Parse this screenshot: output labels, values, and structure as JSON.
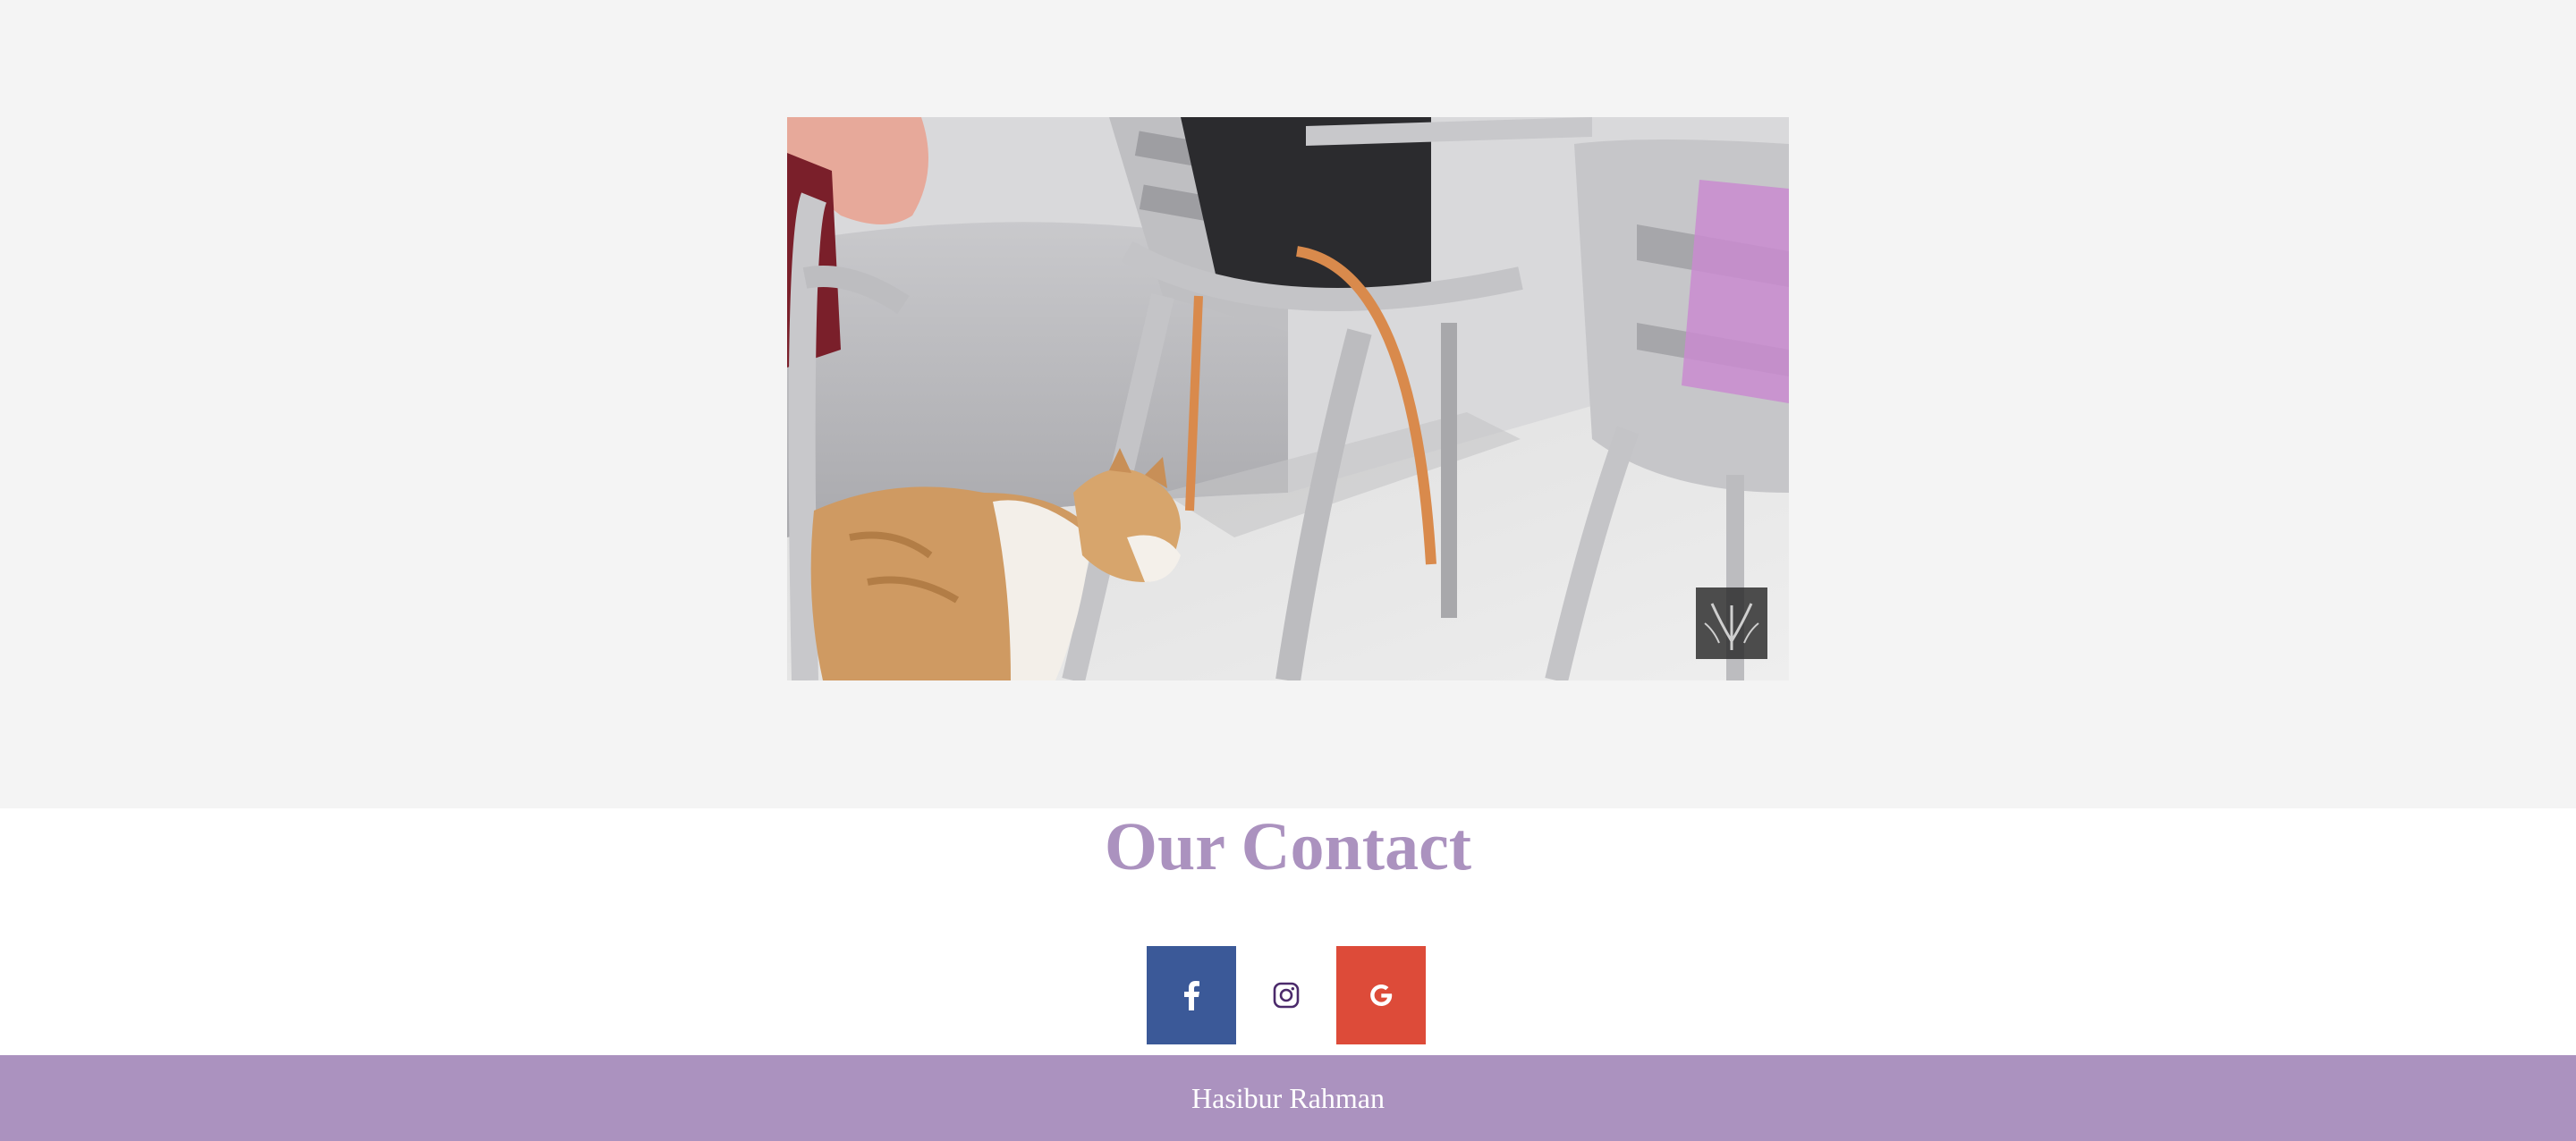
{
  "video": {
    "watermark_icon": "bamboo-logo-icon"
  },
  "contact": {
    "title": "Our Contact",
    "socials": [
      {
        "name": "facebook",
        "icon": "facebook-icon",
        "color": "#3b5998"
      },
      {
        "name": "instagram",
        "icon": "instagram-icon",
        "color": "#4b2a6b"
      },
      {
        "name": "google",
        "icon": "google-icon",
        "color": "#dd4b39"
      }
    ]
  },
  "footer": {
    "text": "Hasibur Rahman",
    "color": "#ab92bf"
  },
  "colors": {
    "accent": "#ab92bf",
    "video_section_bg": "#f4f4f4"
  }
}
